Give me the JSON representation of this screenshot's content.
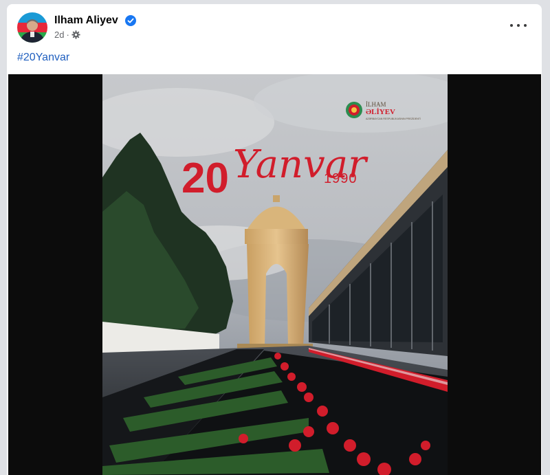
{
  "post": {
    "author": "Ilham Aliyev",
    "time": "2d",
    "time_separator": "·",
    "audience_icon": "gear-icon",
    "verified_icon": "verified-badge-icon",
    "more_icon": "more-options-icon",
    "hashtag": "#20Yanvar"
  },
  "poster": {
    "day": "20",
    "month": "Yanvar",
    "year": "1990",
    "logo_name_line1": "İLHAM",
    "logo_name_line2": "ƏLİYEV",
    "logo_caption": "AZƏRBAYCAN RESPUBLİKASININ PREZİDENTİ"
  },
  "colors": {
    "link": "#1f5fbf",
    "verified": "#1877f2",
    "poster_red": "#d11d2b",
    "media_background": "#0c0c0c"
  }
}
